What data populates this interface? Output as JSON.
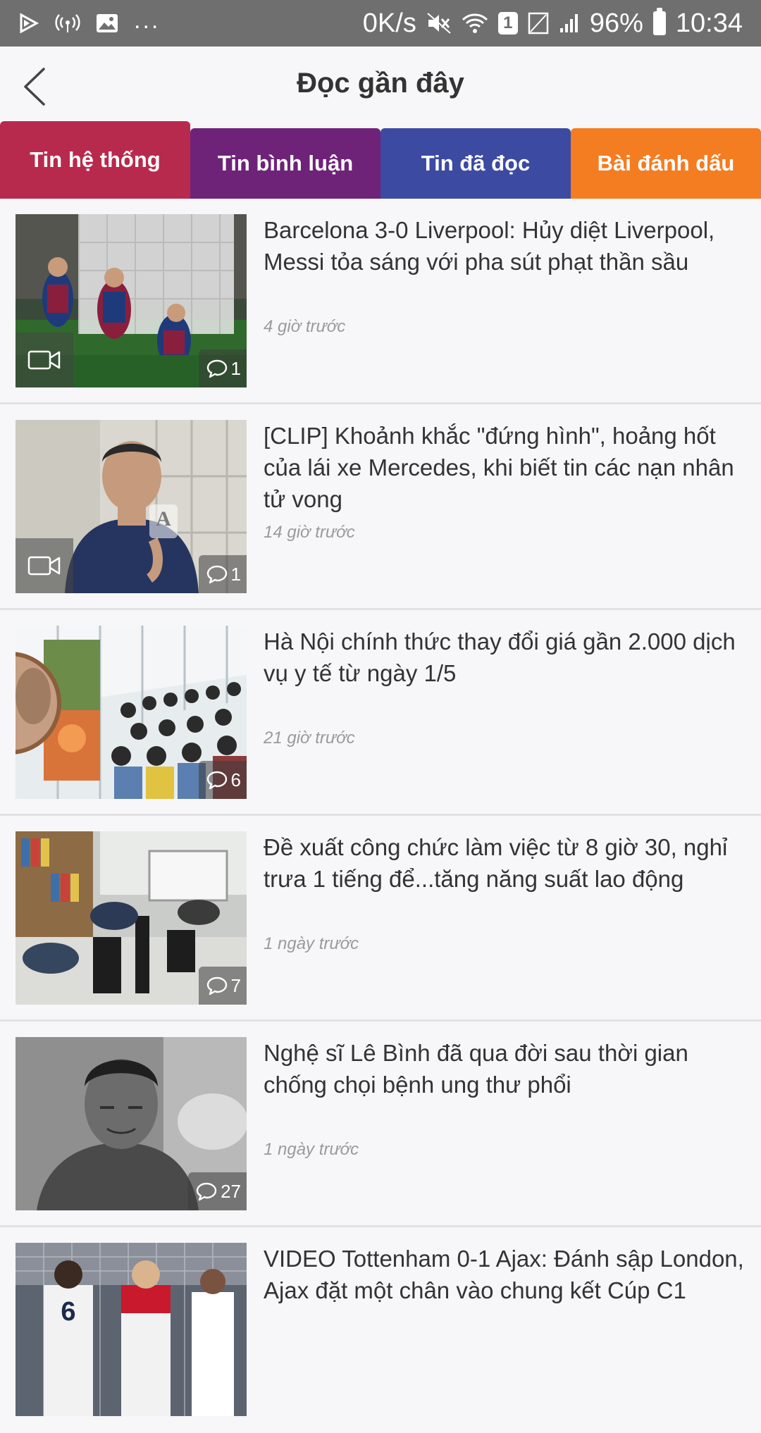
{
  "status_bar": {
    "left_more": "...",
    "net_speed": "0K/s",
    "sim_label": "1",
    "battery": "96%",
    "time": "10:34"
  },
  "header": {
    "title": "Đọc gần đây",
    "back_icon": "chevron-left-icon"
  },
  "tabs": [
    {
      "label": "Tin hệ thống",
      "color": "#b82a4d",
      "active": true
    },
    {
      "label": "Tin bình luận",
      "color": "#6e2378"
    },
    {
      "label": "Tin đã đọc",
      "color": "#3c4aa2"
    },
    {
      "label": "Bài đánh dấu",
      "color": "#f47c21"
    }
  ],
  "news": [
    {
      "title": "Barcelona 3-0 Liverpool: Hủy diệt Liverpool, Messi tỏa sáng với pha sút phạt thần sầu",
      "time": "4 giờ trước",
      "comments": "1",
      "video": true
    },
    {
      "title": "[CLIP] Khoảnh khắc \"đứng hình\", hoảng hốt của lái xe Mercedes, khi biết tin các nạn nhân tử vong",
      "time": "14 giờ trước",
      "comments": "1",
      "video": true
    },
    {
      "title": "Hà Nội chính thức thay đổi giá gần 2.000 dịch vụ y tế từ ngày 1/5",
      "time": "21 giờ trước",
      "comments": "6",
      "video": false
    },
    {
      "title": "Đề xuất công chức làm việc từ 8 giờ 30, nghỉ trưa 1 tiếng để...tăng năng suất lao động",
      "time": "1 ngày trước",
      "comments": "7",
      "video": false
    },
    {
      "title": "Nghệ sĩ Lê Bình đã qua đời sau thời gian chống chọi bệnh ung thư phổi",
      "time": "1 ngày trước",
      "comments": "27",
      "video": false
    },
    {
      "title": "VIDEO Tottenham 0-1 Ajax: Đánh sập London, Ajax đặt một chân vào chung kết Cúp C1",
      "time": "",
      "comments": "",
      "video": false
    }
  ]
}
